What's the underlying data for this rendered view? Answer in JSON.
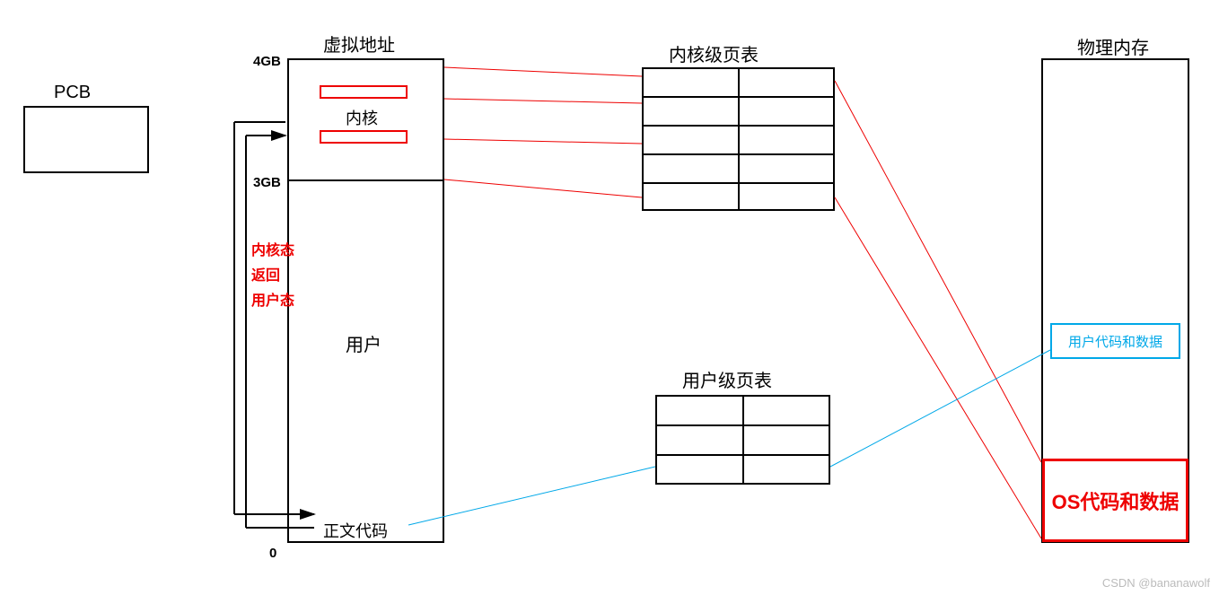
{
  "pcb": {
    "label": "PCB"
  },
  "virtual_address": {
    "title": "虚拟地址",
    "top_marker": "4GB",
    "mid_marker": "3GB",
    "bottom_marker": "0",
    "kernel_label": "内核",
    "user_label": "用户",
    "code_label": "正文代码",
    "transition": {
      "line1": "内核态",
      "line2": "返回",
      "line3": "用户态"
    }
  },
  "kernel_page_table": {
    "title": "内核级页表"
  },
  "user_page_table": {
    "title": "用户级页表"
  },
  "physical_memory": {
    "title": "物理内存",
    "user_block": "用户代码和数据",
    "os_block": "OS代码和数据"
  },
  "watermark": "CSDN @bananawolf"
}
